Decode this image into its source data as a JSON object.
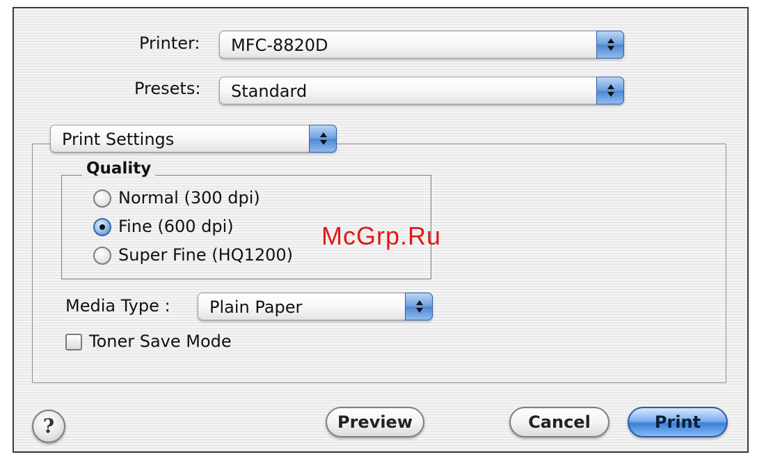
{
  "printer": {
    "label": "Printer:",
    "value": "MFC-8820D"
  },
  "presets": {
    "label": "Presets:",
    "value": "Standard"
  },
  "panel_selector": {
    "value": "Print Settings"
  },
  "quality": {
    "title": "Quality",
    "options": [
      {
        "label": "Normal (300 dpi)",
        "selected": false
      },
      {
        "label": "Fine (600 dpi)",
        "selected": true
      },
      {
        "label": "Super Fine (HQ1200)",
        "selected": false
      }
    ]
  },
  "media_type": {
    "label": "Media Type :",
    "value": "Plain Paper"
  },
  "toner_save": {
    "label": "Toner Save Mode",
    "checked": false
  },
  "buttons": {
    "help": "?",
    "preview": "Preview",
    "cancel": "Cancel",
    "print": "Print"
  },
  "watermark": "McGrp.Ru",
  "colors": {
    "accent": "#4d86d2",
    "watermark": "#e01818"
  }
}
